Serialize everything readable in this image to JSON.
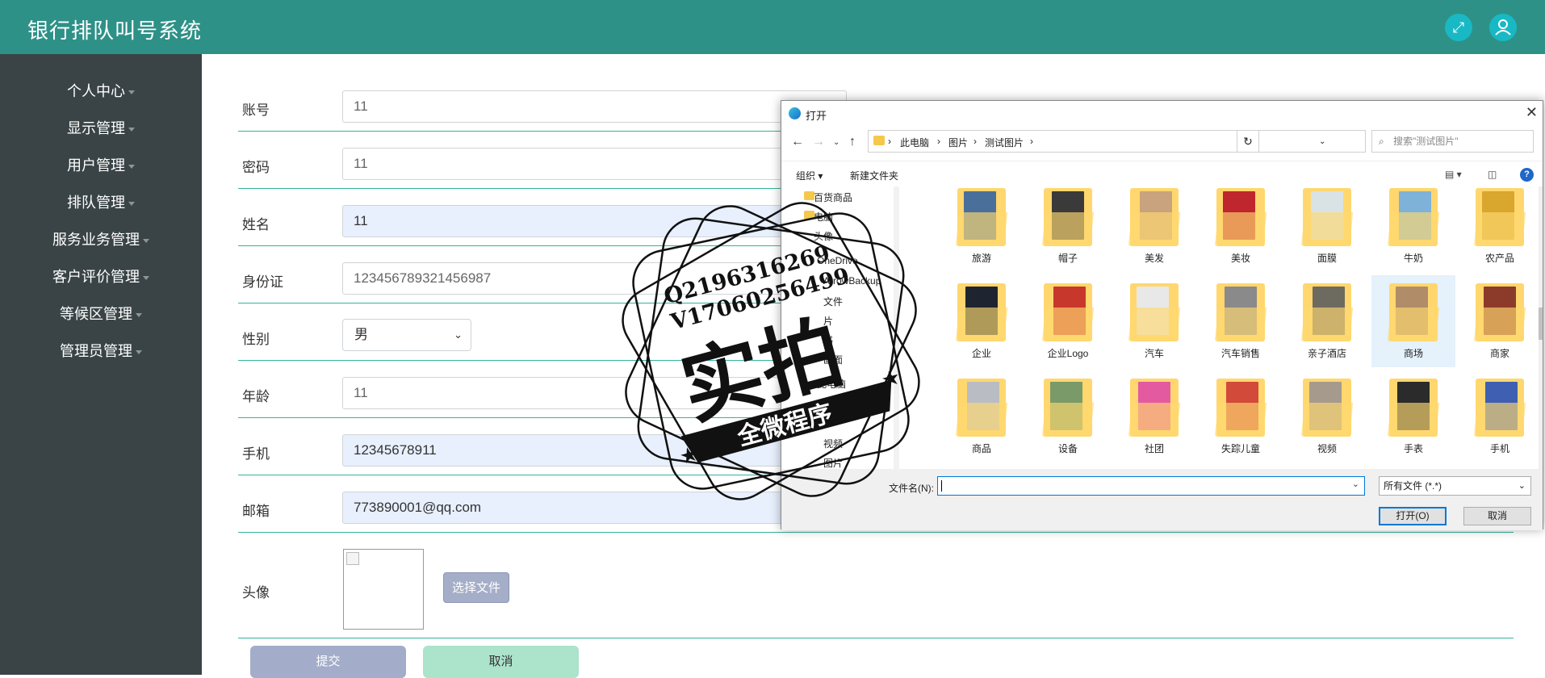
{
  "header": {
    "title": "银行排队叫号系统"
  },
  "sidebar": {
    "items": [
      {
        "label": "个人中心"
      },
      {
        "label": "显示管理"
      },
      {
        "label": "用户管理"
      },
      {
        "label": "排队管理"
      },
      {
        "label": "服务业务管理"
      },
      {
        "label": "客户评价管理"
      },
      {
        "label": "等候区管理"
      },
      {
        "label": "管理员管理"
      }
    ]
  },
  "form": {
    "account": {
      "label": "账号",
      "value": "11"
    },
    "password": {
      "label": "密码",
      "value": "11"
    },
    "name": {
      "label": "姓名",
      "value": "11"
    },
    "id_card": {
      "label": "身份证",
      "value": "123456789321456987"
    },
    "gender": {
      "label": "性别",
      "value": "男"
    },
    "age": {
      "label": "年龄",
      "value": "11"
    },
    "phone": {
      "label": "手机",
      "value": "12345678911"
    },
    "email": {
      "label": "邮箱",
      "value": "773890001@qq.com"
    },
    "avatar": {
      "label": "头像"
    },
    "choose_file": "选择文件",
    "submit": "提交",
    "cancel": "取消"
  },
  "dialog": {
    "title": "打开",
    "breadcrumb": [
      "此电脑",
      "图片",
      "测试图片"
    ],
    "search_placeholder": "搜索\"测试图片\"",
    "organize": "组织",
    "new_folder": "新建文件夹",
    "nav_items": [
      "百货商品",
      "电脑",
      "头像",
      "OneDrive",
      "ArrowBackup",
      "文件",
      "片",
      "书",
      "画面",
      "此电脑",
      "",
      "视频",
      "图片"
    ],
    "files": [
      {
        "name": "旅游",
        "color": "#4a6f9a"
      },
      {
        "name": "帽子",
        "color": "#3a3a3a"
      },
      {
        "name": "美发",
        "color": "#c9a37d"
      },
      {
        "name": "美妆",
        "color": "#c0262d"
      },
      {
        "name": "面膜",
        "color": "#d9e3e6"
      },
      {
        "name": "牛奶",
        "color": "#7fb2d8"
      },
      {
        "name": "农产品",
        "color": "#d9a62e"
      },
      {
        "name": "企业",
        "color": "#1f2530"
      },
      {
        "name": "企业Logo",
        "color": "#c8372c"
      },
      {
        "name": "汽车",
        "color": "#e8e8e8"
      },
      {
        "name": "汽车销售",
        "color": "#8a8a8a"
      },
      {
        "name": "亲子酒店",
        "color": "#6d6a60"
      },
      {
        "name": "商场",
        "color": "#b08c68"
      },
      {
        "name": "商家",
        "color": "#8c3a2a"
      },
      {
        "name": "商品",
        "color": "#b9bcc2"
      },
      {
        "name": "设备",
        "color": "#7a9a6a"
      },
      {
        "name": "社团",
        "color": "#e45aa0"
      },
      {
        "name": "失踪儿童",
        "color": "#d24a3a"
      },
      {
        "name": "视频",
        "color": "#a69a8c"
      },
      {
        "name": "手表",
        "color": "#2b2b2b"
      },
      {
        "name": "手机",
        "color": "#3e5fb2"
      }
    ],
    "filename_label": "文件名(N):",
    "filename_value": "",
    "filetype": "所有文件 (*.*)",
    "open": "打开(O)",
    "cancel": "取消"
  },
  "watermark": {
    "line1": "Q2196316269",
    "line2": "V17060256499",
    "main": "实拍",
    "sub": "全微程序"
  }
}
